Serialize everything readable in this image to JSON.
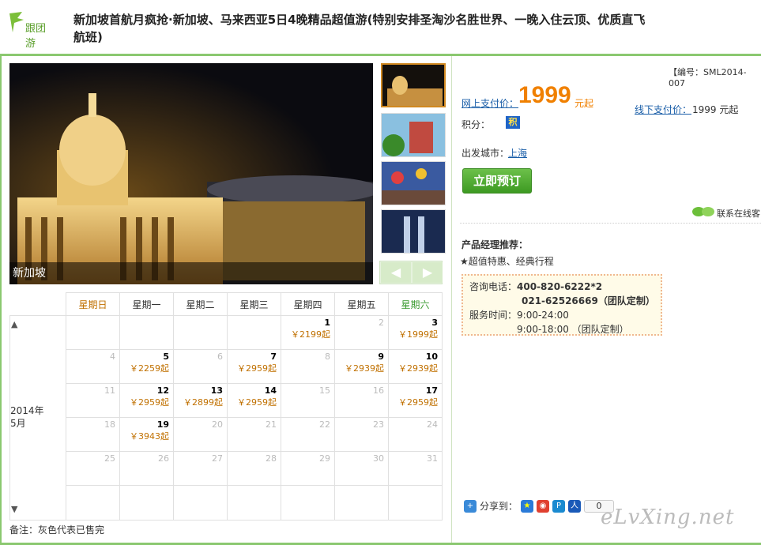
{
  "header": {
    "logo_text": "跟团游",
    "title": "新加坡首航月疯抢·新加坡、马来西亚5日4晚精品超值游(特别安排圣淘沙名胜世界、一晚入住云顶、优质直飞航班)"
  },
  "gallery": {
    "caption": "新加坡",
    "prev": "◀",
    "next": "▶"
  },
  "calendar": {
    "weekdays": [
      "星期日",
      "星期一",
      "星期二",
      "星期三",
      "星期四",
      "星期五",
      "星期六"
    ],
    "year_label": "2014年",
    "month_label": "5月",
    "up": "▲",
    "down": "▼",
    "weeks": [
      [
        {
          "d": "",
          "p": ""
        },
        {
          "d": "",
          "p": ""
        },
        {
          "d": "",
          "p": ""
        },
        {
          "d": "",
          "p": ""
        },
        {
          "d": "1",
          "p": "￥2199起"
        },
        {
          "d": "2",
          "p": ""
        },
        {
          "d": "3",
          "p": "￥1999起"
        }
      ],
      [
        {
          "d": "4",
          "p": ""
        },
        {
          "d": "5",
          "p": "￥2259起"
        },
        {
          "d": "6",
          "p": ""
        },
        {
          "d": "7",
          "p": "￥2959起"
        },
        {
          "d": "8",
          "p": ""
        },
        {
          "d": "9",
          "p": "￥2939起"
        },
        {
          "d": "10",
          "p": "￥2939起"
        }
      ],
      [
        {
          "d": "11",
          "p": ""
        },
        {
          "d": "12",
          "p": "￥2959起"
        },
        {
          "d": "13",
          "p": "￥2899起"
        },
        {
          "d": "14",
          "p": "￥2959起"
        },
        {
          "d": "15",
          "p": ""
        },
        {
          "d": "16",
          "p": ""
        },
        {
          "d": "17",
          "p": "￥2959起"
        }
      ],
      [
        {
          "d": "18",
          "p": ""
        },
        {
          "d": "19",
          "p": "￥3943起"
        },
        {
          "d": "20",
          "p": ""
        },
        {
          "d": "21",
          "p": ""
        },
        {
          "d": "22",
          "p": ""
        },
        {
          "d": "23",
          "p": ""
        },
        {
          "d": "24",
          "p": ""
        }
      ],
      [
        {
          "d": "25",
          "p": ""
        },
        {
          "d": "26",
          "p": ""
        },
        {
          "d": "27",
          "p": ""
        },
        {
          "d": "28",
          "p": ""
        },
        {
          "d": "29",
          "p": ""
        },
        {
          "d": "30",
          "p": ""
        },
        {
          "d": "31",
          "p": ""
        }
      ],
      [
        {
          "d": "",
          "p": ""
        },
        {
          "d": "",
          "p": ""
        },
        {
          "d": "",
          "p": ""
        },
        {
          "d": "",
          "p": ""
        },
        {
          "d": "",
          "p": ""
        },
        {
          "d": "",
          "p": ""
        },
        {
          "d": "",
          "p": ""
        }
      ]
    ],
    "note": "备注：灰色代表已售完"
  },
  "info": {
    "code": "【编号：SML2014-007",
    "online_label": "网上支付价：",
    "online_price": "1999",
    "online_unit": "元起",
    "offline_label": "线下支付价：",
    "offline_price": "1999 元起",
    "points_label": "积分：",
    "points_badge": "积",
    "city_label": "出发城市：",
    "city": "上海",
    "book_label": "立即预订",
    "contact": "联系在线客",
    "rec_title": "产品经理推荐：",
    "rec_text": "★超值特惠、经典行程",
    "phone_label": "咨询电话：",
    "phone1": "400-820-6222*2",
    "phone2": "021-62526669（团队定制）",
    "hours_label": "服务时间：",
    "hours1": "9:00-24:00",
    "hours2": "9:00-18:00 （团队定制）",
    "share_label": "分享到：",
    "share_count": "0"
  },
  "watermark": "eLvXing.net"
}
